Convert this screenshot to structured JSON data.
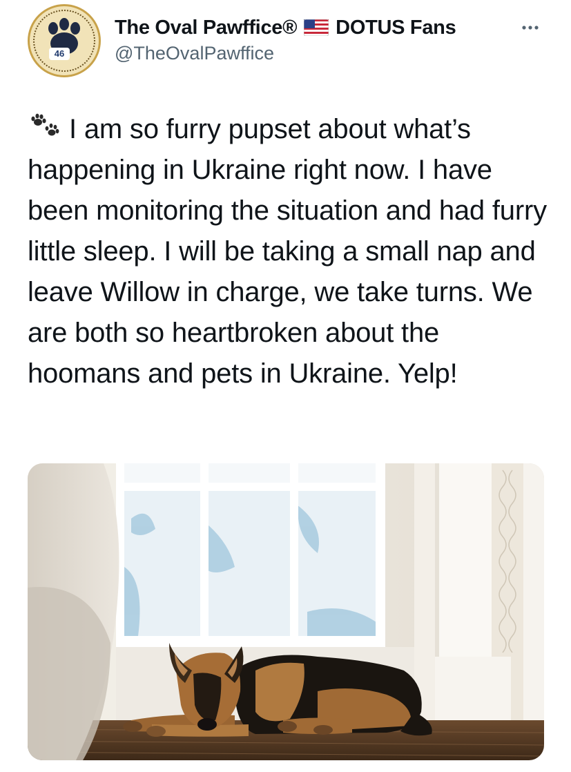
{
  "account": {
    "display_name": "The Oval Pawffice®",
    "name_suffix": "DOTUS Fans",
    "handle": "@TheOvalPawffice",
    "avatar_badge": "46",
    "flag_icon": "us-flag-icon"
  },
  "tweet": {
    "lead_icon": "paw-prints-icon",
    "text": "I am so furry pupset about what’s happening in Ukraine right now. I have been monitoring the situation and had furry little sleep. I will be taking a small nap and leave Willow in charge, we take turns. We are both so heartbroken about the hoomans and pets in Ukraine. Yelp!"
  },
  "colors": {
    "text": "#0f1419",
    "secondary": "#536471"
  }
}
